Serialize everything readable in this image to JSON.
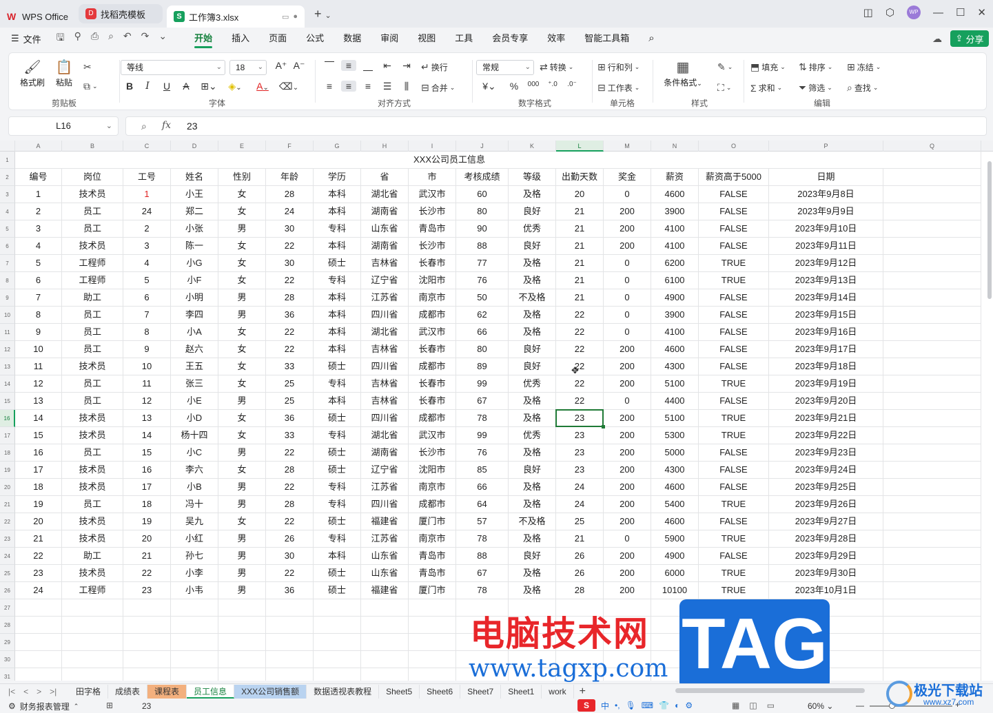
{
  "titlebar": {
    "app_tab": "WPS Office",
    "tab2": "找稻壳模板",
    "active_tab": "工作簿3.xlsx",
    "avatar": "WP"
  },
  "menu": {
    "file": "文件",
    "items": [
      "开始",
      "插入",
      "页面",
      "公式",
      "数据",
      "审阅",
      "视图",
      "工具",
      "会员专享",
      "效率",
      "智能工具箱"
    ],
    "active": "开始",
    "share": "分享"
  },
  "ribbon": {
    "clipboard": {
      "label": "剪贴板",
      "format_painter": "格式刷",
      "paste": "粘贴"
    },
    "font": {
      "label": "字体",
      "family": "等线",
      "size": "18"
    },
    "align": {
      "label": "对齐方式",
      "wrap": "换行",
      "merge": "合并"
    },
    "number": {
      "label": "数字格式",
      "format": "常规",
      "convert": "转换"
    },
    "cells": {
      "label": "单元格",
      "rowcol": "行和列",
      "sheet": "工作表"
    },
    "styles": {
      "label": "样式",
      "cond": "条件格式"
    },
    "edit": {
      "label": "编辑",
      "fill": "填充",
      "sort": "排序",
      "freeze": "冻结",
      "sum": "求和",
      "filter": "筛选",
      "find": "查找"
    }
  },
  "formula": {
    "cell_ref": "L16",
    "fx": "fx",
    "value": "23"
  },
  "columns": [
    "A",
    "B",
    "C",
    "D",
    "E",
    "F",
    "G",
    "H",
    "I",
    "J",
    "K",
    "L",
    "M",
    "N",
    "O",
    "P",
    "Q"
  ],
  "active_col": "L",
  "active_row": 16,
  "rows": [
    "1",
    "2",
    "3",
    "4",
    "5",
    "6",
    "7",
    "8",
    "9",
    "10",
    "11",
    "12",
    "13",
    "14",
    "15",
    "16",
    "17",
    "18",
    "19",
    "20",
    "21",
    "22",
    "23",
    "24",
    "25",
    "26",
    "27",
    "28",
    "29",
    "30",
    "31"
  ],
  "sheet_title": "XXX公司员工信息",
  "headers": [
    "编号",
    "岗位",
    "工号",
    "姓名",
    "性别",
    "年龄",
    "学历",
    "省",
    "市",
    "考核成绩",
    "等级",
    "出勤天数",
    "奖金",
    "薪资",
    "薪资高于5000",
    "日期"
  ],
  "data": [
    [
      "1",
      "技术员",
      "1",
      "小王",
      "女",
      "28",
      "本科",
      "湖北省",
      "武汉市",
      "60",
      "及格",
      "20",
      "0",
      "4600",
      "FALSE",
      "2023年9月8日"
    ],
    [
      "2",
      "员工",
      "24",
      "郑二",
      "女",
      "24",
      "本科",
      "湖南省",
      "长沙市",
      "80",
      "良好",
      "21",
      "200",
      "3900",
      "FALSE",
      "2023年9月9日"
    ],
    [
      "3",
      "员工",
      "2",
      "小张",
      "男",
      "30",
      "专科",
      "山东省",
      "青岛市",
      "90",
      "优秀",
      "21",
      "200",
      "4100",
      "FALSE",
      "2023年9月10日"
    ],
    [
      "4",
      "技术员",
      "3",
      "陈一",
      "女",
      "22",
      "本科",
      "湖南省",
      "长沙市",
      "88",
      "良好",
      "21",
      "200",
      "4100",
      "FALSE",
      "2023年9月11日"
    ],
    [
      "5",
      "工程师",
      "4",
      "小G",
      "女",
      "30",
      "硕士",
      "吉林省",
      "长春市",
      "77",
      "及格",
      "21",
      "0",
      "6200",
      "TRUE",
      "2023年9月12日"
    ],
    [
      "6",
      "工程师",
      "5",
      "小F",
      "女",
      "22",
      "专科",
      "辽宁省",
      "沈阳市",
      "76",
      "及格",
      "21",
      "0",
      "6100",
      "TRUE",
      "2023年9月13日"
    ],
    [
      "7",
      "助工",
      "6",
      "小明",
      "男",
      "28",
      "本科",
      "江苏省",
      "南京市",
      "50",
      "不及格",
      "21",
      "0",
      "4900",
      "FALSE",
      "2023年9月14日"
    ],
    [
      "8",
      "员工",
      "7",
      "李四",
      "男",
      "36",
      "本科",
      "四川省",
      "成都市",
      "62",
      "及格",
      "22",
      "0",
      "3900",
      "FALSE",
      "2023年9月15日"
    ],
    [
      "9",
      "员工",
      "8",
      "小A",
      "女",
      "22",
      "本科",
      "湖北省",
      "武汉市",
      "66",
      "及格",
      "22",
      "0",
      "4100",
      "FALSE",
      "2023年9月16日"
    ],
    [
      "10",
      "员工",
      "9",
      "赵六",
      "女",
      "22",
      "本科",
      "吉林省",
      "长春市",
      "80",
      "良好",
      "22",
      "200",
      "4600",
      "FALSE",
      "2023年9月17日"
    ],
    [
      "11",
      "技术员",
      "10",
      "王五",
      "女",
      "33",
      "硕士",
      "四川省",
      "成都市",
      "89",
      "良好",
      "22",
      "200",
      "4300",
      "FALSE",
      "2023年9月18日"
    ],
    [
      "12",
      "员工",
      "11",
      "张三",
      "女",
      "25",
      "专科",
      "吉林省",
      "长春市",
      "99",
      "优秀",
      "22",
      "200",
      "5100",
      "TRUE",
      "2023年9月19日"
    ],
    [
      "13",
      "员工",
      "12",
      "小E",
      "男",
      "25",
      "本科",
      "吉林省",
      "长春市",
      "67",
      "及格",
      "22",
      "0",
      "4400",
      "FALSE",
      "2023年9月20日"
    ],
    [
      "14",
      "技术员",
      "13",
      "小D",
      "女",
      "36",
      "硕士",
      "四川省",
      "成都市",
      "78",
      "及格",
      "23",
      "200",
      "5100",
      "TRUE",
      "2023年9月21日"
    ],
    [
      "15",
      "技术员",
      "14",
      "杨十四",
      "女",
      "33",
      "专科",
      "湖北省",
      "武汉市",
      "99",
      "优秀",
      "23",
      "200",
      "5300",
      "TRUE",
      "2023年9月22日"
    ],
    [
      "16",
      "员工",
      "15",
      "小C",
      "男",
      "22",
      "硕士",
      "湖南省",
      "长沙市",
      "76",
      "及格",
      "23",
      "200",
      "5000",
      "FALSE",
      "2023年9月23日"
    ],
    [
      "17",
      "技术员",
      "16",
      "李六",
      "女",
      "28",
      "硕士",
      "辽宁省",
      "沈阳市",
      "85",
      "良好",
      "23",
      "200",
      "4300",
      "FALSE",
      "2023年9月24日"
    ],
    [
      "18",
      "技术员",
      "17",
      "小B",
      "男",
      "22",
      "专科",
      "江苏省",
      "南京市",
      "66",
      "及格",
      "24",
      "200",
      "4600",
      "FALSE",
      "2023年9月25日"
    ],
    [
      "19",
      "员工",
      "18",
      "冯十",
      "男",
      "28",
      "专科",
      "四川省",
      "成都市",
      "64",
      "及格",
      "24",
      "200",
      "5400",
      "TRUE",
      "2023年9月26日"
    ],
    [
      "20",
      "技术员",
      "19",
      "吴九",
      "女",
      "22",
      "硕士",
      "福建省",
      "厦门市",
      "57",
      "不及格",
      "25",
      "200",
      "4600",
      "FALSE",
      "2023年9月27日"
    ],
    [
      "21",
      "技术员",
      "20",
      "小红",
      "男",
      "26",
      "专科",
      "江苏省",
      "南京市",
      "78",
      "及格",
      "21",
      "0",
      "5900",
      "TRUE",
      "2023年9月28日"
    ],
    [
      "22",
      "助工",
      "21",
      "孙七",
      "男",
      "30",
      "本科",
      "山东省",
      "青岛市",
      "88",
      "良好",
      "26",
      "200",
      "4900",
      "FALSE",
      "2023年9月29日"
    ],
    [
      "23",
      "技术员",
      "22",
      "小李",
      "男",
      "22",
      "硕士",
      "山东省",
      "青岛市",
      "67",
      "及格",
      "26",
      "200",
      "6000",
      "TRUE",
      "2023年9月30日"
    ],
    [
      "24",
      "工程师",
      "23",
      "小韦",
      "男",
      "36",
      "硕士",
      "福建省",
      "厦门市",
      "78",
      "及格",
      "28",
      "200",
      "10100",
      "TRUE",
      "2023年10月1日"
    ]
  ],
  "sheet_tabs": [
    "田字格",
    "成绩表",
    "课程表",
    "员工信息",
    "XXX公司销售额",
    "数据透视表教程",
    "Sheet5",
    "Sheet6",
    "Sheet7",
    "Sheet1",
    "work"
  ],
  "current_sheet": "员工信息",
  "status": {
    "mode": "财务报表管理",
    "value": "23",
    "zoom": "60%",
    "ime": "中"
  },
  "watermark": {
    "cn": "电脑技术网",
    "url": "www.tagxp.com",
    "tag": "TAG",
    "brand": "极光下载站",
    "brand_url": "www.xz7.com"
  }
}
